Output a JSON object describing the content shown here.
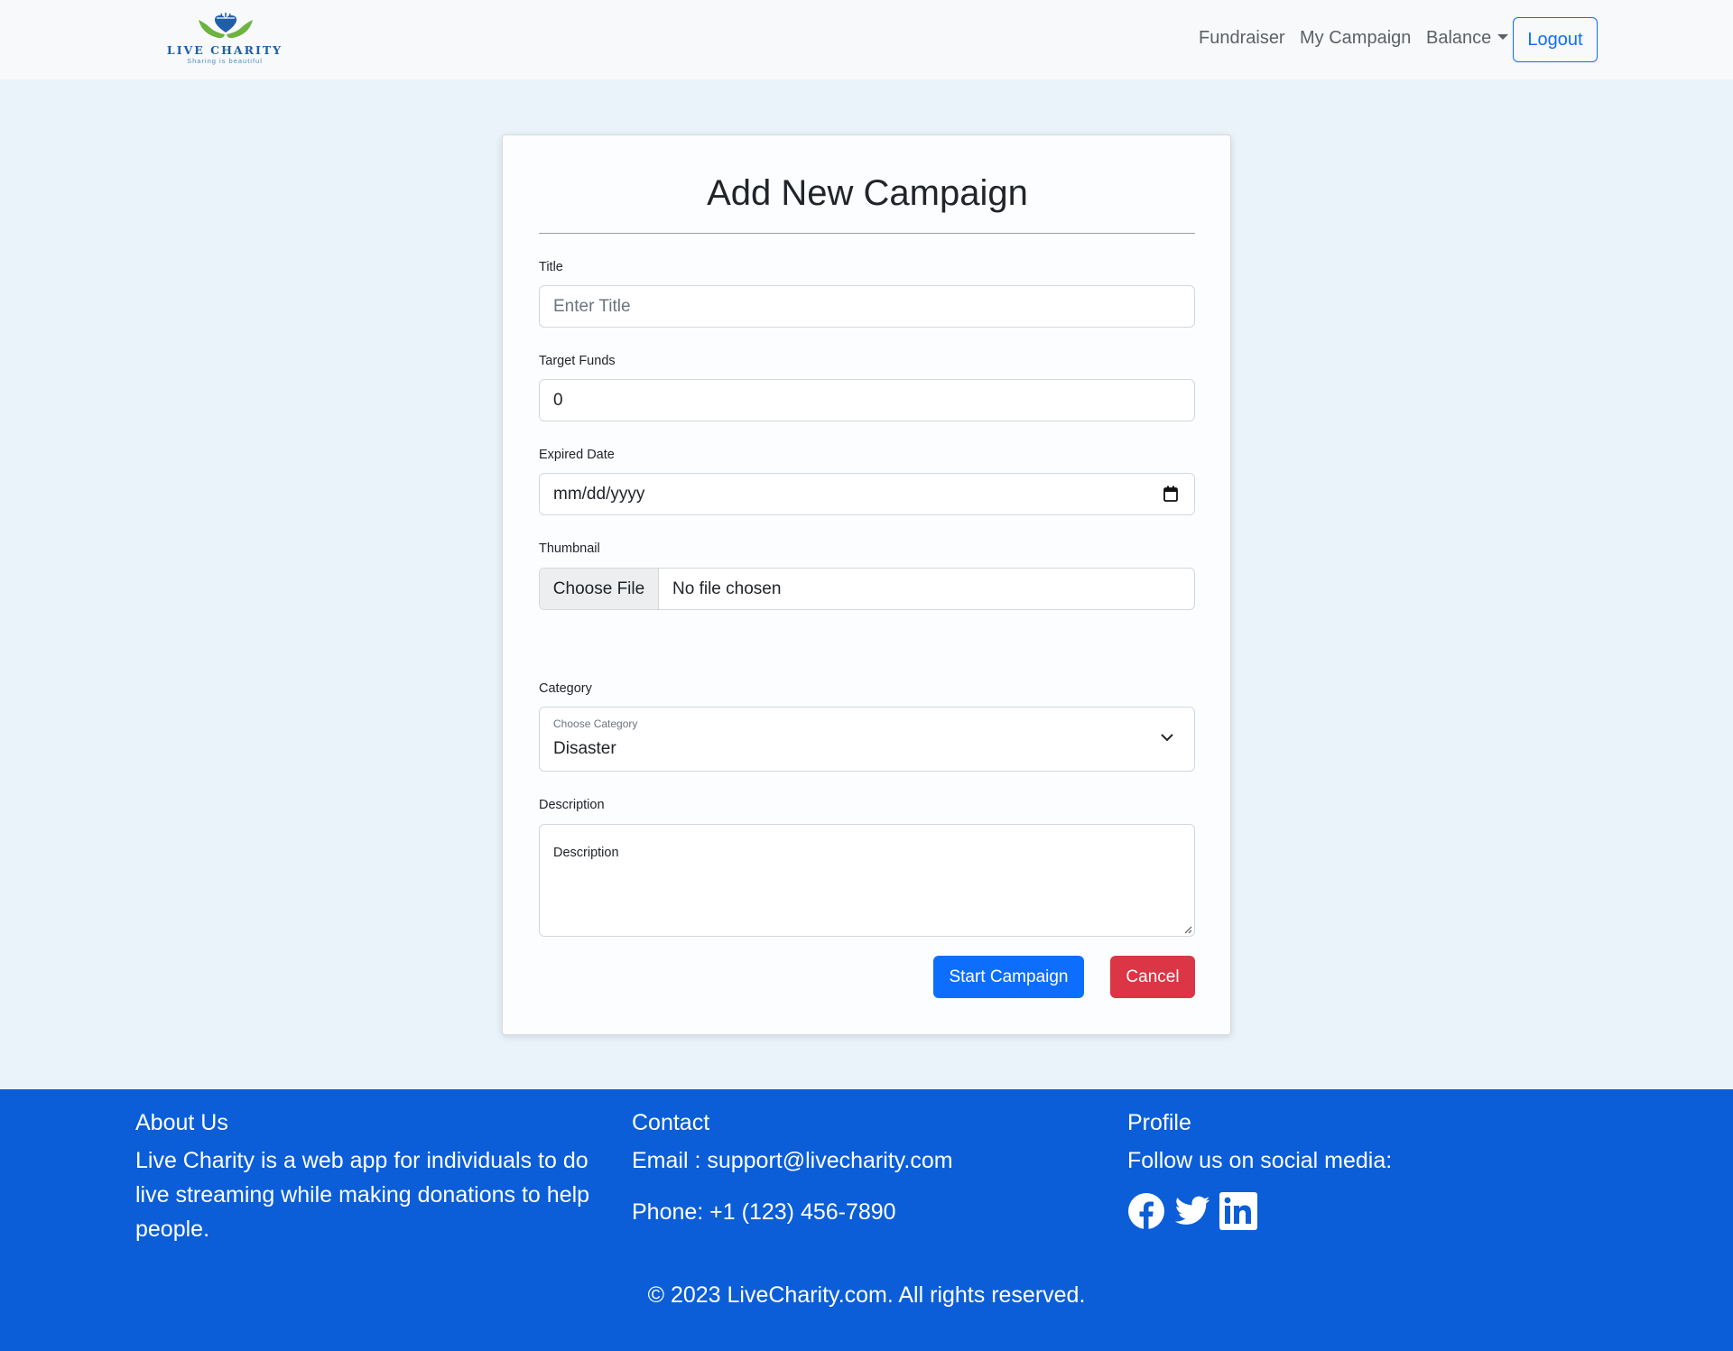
{
  "brand": {
    "name": "LIVE CHARITY",
    "tagline": "Sharing is beautiful",
    "colors": {
      "leaf": "#6cb33f",
      "heart": "#1f5fa8"
    }
  },
  "nav": {
    "links": [
      "Fundraiser",
      "My Campaign",
      "Balance"
    ],
    "logout_label": "Logout"
  },
  "form": {
    "title": "Add New Campaign",
    "fields": {
      "title": {
        "label": "Title",
        "placeholder": "Enter Title"
      },
      "target": {
        "label": "Target Funds",
        "value": "0"
      },
      "expired": {
        "label": "Expired Date",
        "value": "mm/dd/yyyy"
      },
      "thumbnail": {
        "label": "Thumbnail",
        "button": "Choose File",
        "status": "No file chosen"
      },
      "category": {
        "label": "Category",
        "floating_label": "Choose Category",
        "value": "Disaster"
      },
      "description": {
        "label": "Description",
        "placeholder": "Description"
      }
    },
    "buttons": {
      "submit": "Start Campaign",
      "cancel": "Cancel"
    }
  },
  "footer": {
    "about": {
      "heading": "About Us",
      "text": "Live Charity is a web app for individuals to do live streaming while making donations to help people."
    },
    "contact": {
      "heading": "Contact",
      "email": "Email : support@livecharity.com",
      "phone": "Phone: +1 (123) 456-7890"
    },
    "profile": {
      "heading": "Profile",
      "text": "Follow us on social media:",
      "icons": [
        "facebook-icon",
        "twitter-icon",
        "linkedin-icon"
      ]
    },
    "copyright": "© 2023 LiveCharity.com. All rights reserved."
  },
  "colors": {
    "primary": "#0d6efd",
    "danger": "#dc3545",
    "footer_bg": "#0b5ed7",
    "page_bg": "#eaf2fa"
  }
}
